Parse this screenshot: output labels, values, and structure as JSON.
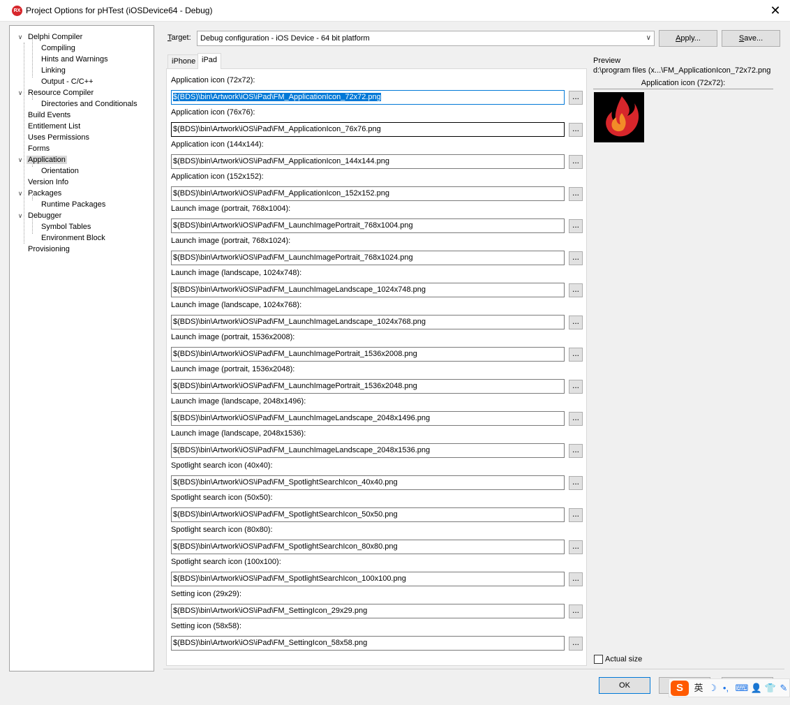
{
  "window": {
    "logo_text": "RX",
    "title": "Project Options for pHTest  (iOSDevice64 - Debug)",
    "close_glyph": "✕"
  },
  "tree": [
    {
      "label": "Delphi Compiler",
      "expander": "∨"
    },
    {
      "label": "Compiling"
    },
    {
      "label": "Hints and Warnings"
    },
    {
      "label": "Linking"
    },
    {
      "label": "Output - C/C++"
    },
    {
      "label": "Resource Compiler",
      "expander": "∨"
    },
    {
      "label": "Directories and Conditionals"
    },
    {
      "label": "Build Events"
    },
    {
      "label": "Entitlement List"
    },
    {
      "label": "Uses Permissions"
    },
    {
      "label": "Forms"
    },
    {
      "label": "Application",
      "expander": "∨",
      "selected": true
    },
    {
      "label": "Orientation"
    },
    {
      "label": "Version Info"
    },
    {
      "label": "Packages",
      "expander": "∨"
    },
    {
      "label": "Runtime Packages"
    },
    {
      "label": "Debugger",
      "expander": "∨"
    },
    {
      "label": "Symbol Tables"
    },
    {
      "label": "Environment Block"
    },
    {
      "label": "Provisioning"
    }
  ],
  "target": {
    "label_prefix": "T",
    "label_rest": "arget:",
    "value": "Debug configuration - iOS Device - 64 bit platform",
    "chevron": "∨"
  },
  "buttons": {
    "apply_u": "A",
    "apply_rest": "pply...",
    "save_u": "S",
    "save_rest": "ave...",
    "ok": "OK",
    "browse": "..."
  },
  "tabs": [
    {
      "label": "iPhone"
    },
    {
      "label": "iPad",
      "active": true
    }
  ],
  "fields": [
    {
      "label": "Application icon (72x72):",
      "value": "$(BDS)\\bin\\Artwork\\iOS\\iPad\\FM_ApplicationIcon_72x72.png",
      "state": "focused"
    },
    {
      "label": "Application icon (76x76):",
      "value": "$(BDS)\\bin\\Artwork\\iOS\\iPad\\FM_ApplicationIcon_76x76.png",
      "state": "hover"
    },
    {
      "label": "Application icon (144x144):",
      "value": "$(BDS)\\bin\\Artwork\\iOS\\iPad\\FM_ApplicationIcon_144x144.png"
    },
    {
      "label": "Application icon (152x152):",
      "value": "$(BDS)\\bin\\Artwork\\iOS\\iPad\\FM_ApplicationIcon_152x152.png"
    },
    {
      "label": "Launch image (portrait, 768x1004):",
      "value": "$(BDS)\\bin\\Artwork\\iOS\\iPad\\FM_LaunchImagePortrait_768x1004.png"
    },
    {
      "label": "Launch image (portrait, 768x1024):",
      "value": "$(BDS)\\bin\\Artwork\\iOS\\iPad\\FM_LaunchImagePortrait_768x1024.png"
    },
    {
      "label": "Launch image (landscape, 1024x748):",
      "value": "$(BDS)\\bin\\Artwork\\iOS\\iPad\\FM_LaunchImageLandscape_1024x748.png"
    },
    {
      "label": "Launch image (landscape, 1024x768):",
      "value": "$(BDS)\\bin\\Artwork\\iOS\\iPad\\FM_LaunchImageLandscape_1024x768.png"
    },
    {
      "label": "Launch image (portrait, 1536x2008):",
      "value": "$(BDS)\\bin\\Artwork\\iOS\\iPad\\FM_LaunchImagePortrait_1536x2008.png"
    },
    {
      "label": "Launch image (portrait, 1536x2048):",
      "value": "$(BDS)\\bin\\Artwork\\iOS\\iPad\\FM_LaunchImagePortrait_1536x2048.png"
    },
    {
      "label": "Launch image (landscape, 2048x1496):",
      "value": "$(BDS)\\bin\\Artwork\\iOS\\iPad\\FM_LaunchImageLandscape_2048x1496.png"
    },
    {
      "label": "Launch image (landscape, 2048x1536):",
      "value": "$(BDS)\\bin\\Artwork\\iOS\\iPad\\FM_LaunchImageLandscape_2048x1536.png"
    },
    {
      "label": "Spotlight search icon (40x40):",
      "value": "$(BDS)\\bin\\Artwork\\iOS\\iPad\\FM_SpotlightSearchIcon_40x40.png"
    },
    {
      "label": "Spotlight search icon (50x50):",
      "value": "$(BDS)\\bin\\Artwork\\iOS\\iPad\\FM_SpotlightSearchIcon_50x50.png"
    },
    {
      "label": "Spotlight search icon (80x80):",
      "value": "$(BDS)\\bin\\Artwork\\iOS\\iPad\\FM_SpotlightSearchIcon_80x80.png"
    },
    {
      "label": "Spotlight search icon (100x100):",
      "value": "$(BDS)\\bin\\Artwork\\iOS\\iPad\\FM_SpotlightSearchIcon_100x100.png"
    },
    {
      "label": "Setting icon (29x29):",
      "value": "$(BDS)\\bin\\Artwork\\iOS\\iPad\\FM_SettingIcon_29x29.png"
    },
    {
      "label": "Setting icon (58x58):",
      "value": "$(BDS)\\bin\\Artwork\\iOS\\iPad\\FM_SettingIcon_58x58.png"
    }
  ],
  "preview": {
    "title": "Preview",
    "path": "d:\\program files (x...\\FM_ApplicationIcon_72x72.png",
    "caption": "Application icon (72x72):",
    "image_icon": "flame-icon",
    "actual_size_label": "Actual size",
    "actual_size_checked": false
  },
  "ime": {
    "logo": "S",
    "lang": "英",
    "moon": "☽",
    "punct": "•,",
    "keyboard": "⌨",
    "user": "👤",
    "shirt": "👕",
    "tool": "✎"
  },
  "colors": {
    "accent": "#0078d7",
    "logo_red": "#d7262b",
    "ime_orange": "#ff5a00"
  }
}
